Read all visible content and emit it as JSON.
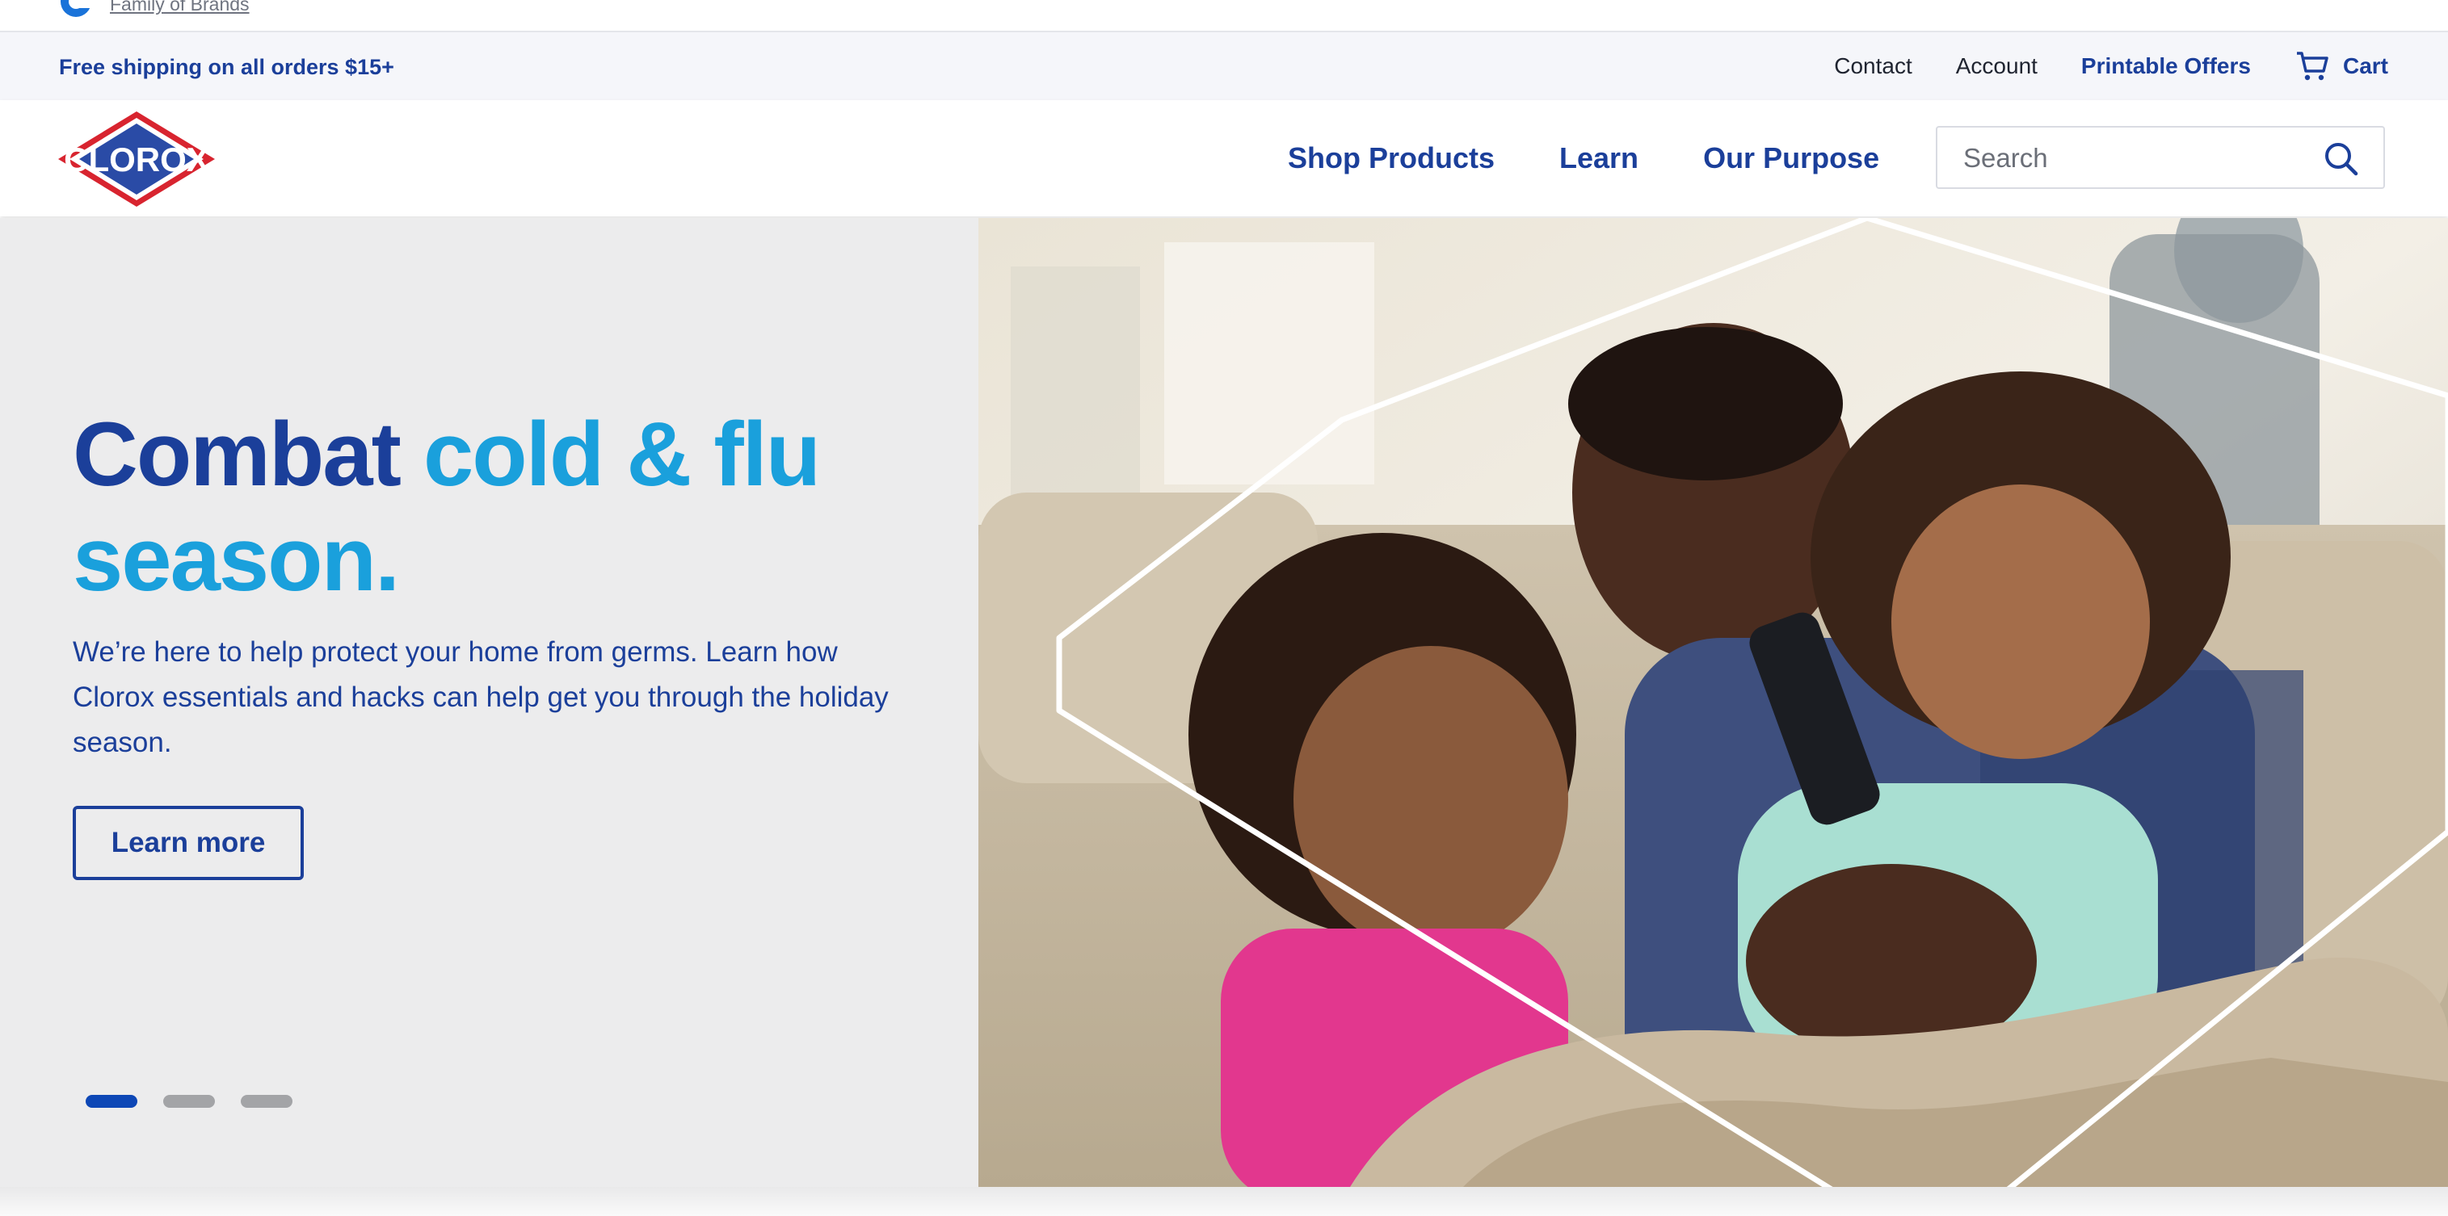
{
  "family_bar": {
    "link_label": "Family of Brands"
  },
  "utility_bar": {
    "shipping_text": "Free shipping on all orders $15+",
    "links": {
      "contact": "Contact",
      "account": "Account",
      "printable_offers": "Printable Offers",
      "cart": "Cart"
    }
  },
  "nav": {
    "logo_text": "CLOROX",
    "items": [
      "Shop Products",
      "Learn",
      "Our Purpose"
    ],
    "search": {
      "placeholder": "Search",
      "value": ""
    }
  },
  "hero": {
    "headline_part1": "Combat",
    "headline_part2": "cold & flu season.",
    "description": "We’re here to help protect your home from germs. Learn how Clorox essentials and hacks can help get you through the holiday season.",
    "cta_label": "Learn more",
    "carousel": {
      "slide_count": 3,
      "active_index": 0
    }
  },
  "colors": {
    "brand_blue": "#1b3f9a",
    "accent_cyan": "#1aa0dc",
    "logo_red": "#d8242f",
    "dot_active": "#0d47b6",
    "dot_inactive": "#a3a4a7"
  }
}
